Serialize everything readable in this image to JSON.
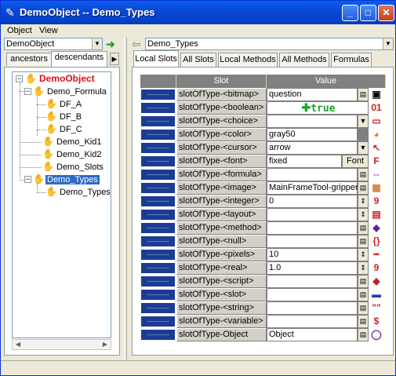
{
  "window": {
    "title": "DemoObject -- Demo_Types",
    "minimize": "_",
    "maximize": "□",
    "close": "✕"
  },
  "menu": [
    "Object",
    "View"
  ],
  "left": {
    "combo_value": "DemoObject",
    "tabs": [
      "ancestors",
      "descendants"
    ],
    "active_tab": "descendants",
    "tree": [
      {
        "label": "DemoObject"
      },
      {
        "label": "Demo_Formula"
      },
      {
        "label": "DF_A"
      },
      {
        "label": "DF_B"
      },
      {
        "label": "DF_C"
      },
      {
        "label": "Demo_Kid1"
      },
      {
        "label": "Demo_Kid2"
      },
      {
        "label": "Demo_Slots"
      },
      {
        "label": "Demo_Types"
      },
      {
        "label": "Demo_Types_"
      }
    ]
  },
  "right": {
    "combo_value": "Demo_Types",
    "tabs": [
      "Local Slots",
      "All Slots",
      "Local Methods",
      "All Methods",
      "Formulas"
    ],
    "active_tab": "Local Slots",
    "columns": [
      "Slot",
      "Value"
    ],
    "rows": [
      {
        "slot": "slotOfType-<bitmap>",
        "value": "question",
        "icon": "bitmap-icon"
      },
      {
        "slot": "slotOfType-<boolean>",
        "value": "true",
        "icon": "boolean-icon",
        "icon_text": "01"
      },
      {
        "slot": "slotOfType-<choice>",
        "value": "",
        "icon": "choice-icon"
      },
      {
        "slot": "slotOfType-<color>",
        "value": "gray50",
        "icon": "color-icon"
      },
      {
        "slot": "slotOfType-<cursor>",
        "value": "arrow",
        "icon": "cursor-icon"
      },
      {
        "slot": "slotOfType-<font>",
        "value": "fixed",
        "icon": "font-icon",
        "button": "Font",
        "icon_text": "F"
      },
      {
        "slot": "slotOfType-<formula>",
        "value": "",
        "icon": "formula-icon"
      },
      {
        "slot": "slotOfType-<image>",
        "value": "MainFrameTool-gripper",
        "icon": "image-icon"
      },
      {
        "slot": "slotOfType-<integer>",
        "value": "0",
        "icon": "integer-icon",
        "icon_text": "9"
      },
      {
        "slot": "slotOfType-<layout>",
        "value": "",
        "icon": "layout-icon"
      },
      {
        "slot": "slotOfType-<method>",
        "value": "",
        "icon": "method-icon"
      },
      {
        "slot": "slotOfType-<null>",
        "value": "",
        "icon": "null-icon",
        "icon_text": "{}"
      },
      {
        "slot": "slotOfType-<pixels>",
        "value": "10",
        "icon": "pixels-icon"
      },
      {
        "slot": "slotOfType-<real>",
        "value": "1.0",
        "icon": "real-icon",
        "icon_text": "9"
      },
      {
        "slot": "slotOfType-<script>",
        "value": "",
        "icon": "script-icon"
      },
      {
        "slot": "slotOfType-<slot>",
        "value": "",
        "icon": "slot-icon"
      },
      {
        "slot": "slotOfType-<string>",
        "value": "",
        "icon": "string-icon",
        "icon_text": "\"\""
      },
      {
        "slot": "slotOfType-<variable>",
        "value": "",
        "icon": "variable-icon",
        "icon_text": "$"
      },
      {
        "slot": "slotOfType-Object",
        "value": "Object",
        "icon": "object-icon"
      }
    ]
  },
  "colors": {
    "titlebar": "#0b47d8",
    "selection": "#316ac5",
    "slot_bar": "#1c3c94",
    "root_text": "#e01010",
    "hand": "#8b1dd8",
    "boolean_green": "#1aa52a"
  }
}
